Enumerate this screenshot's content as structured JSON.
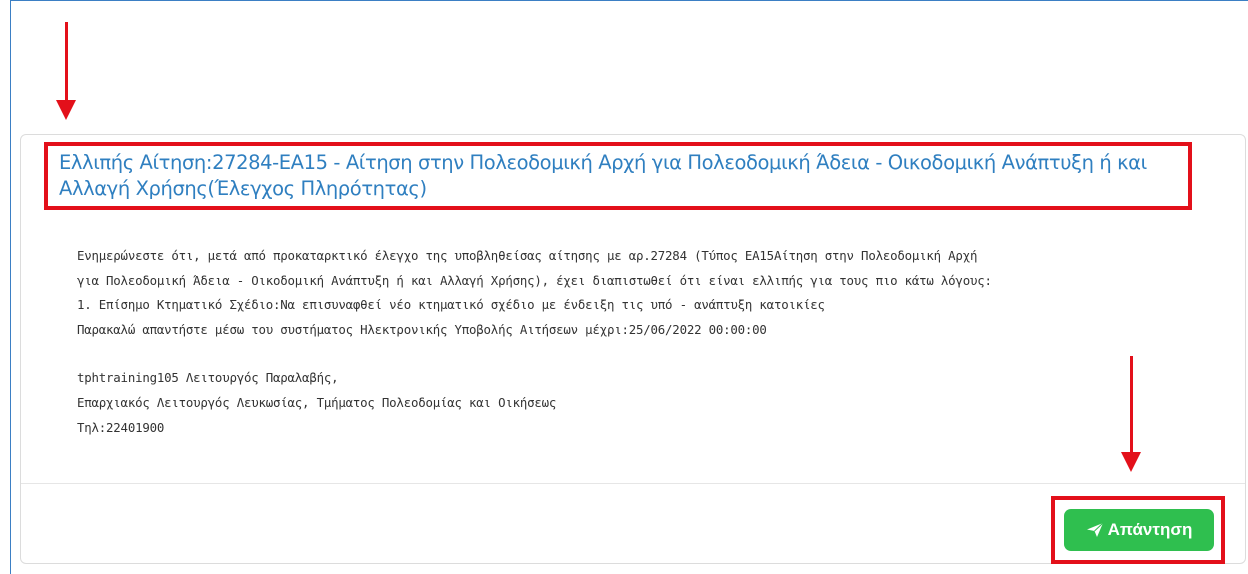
{
  "notice": {
    "title": "Ελλιπής Αίτηση:27284-ΕΑ15 - Αίτηση στην Πολεοδομική Αρχή για Πολεοδομική Άδεια - Οικοδομική Ανάπτυξη ή και Αλλαγή Χρήσης(Έλεγχος Πληρότητας)",
    "body_lines": [
      "Ενημερώνεστε ότι, μετά από προκαταρκτικό έλεγχο της υποβληθείσας αίτησης με αρ.27284 (Τύπος ΕΑ15Αίτηση στην Πολεοδομική Αρχή",
      "για Πολεοδομική Άδεια - Οικοδομική Ανάπτυξη ή και Αλλαγή Χρήσης), έχει διαπιστωθεί ότι είναι ελλιπής για τους πιο κάτω λόγους:",
      "1. Επίσημο Κτηματικό Σχέδιο:Να επισυναφθεί νέο κτηματικό σχέδιο με ένδειξη τις υπό - ανάπτυξη κατοικίες",
      "Παρακαλώ απαντήστε μέσω του συστήματος Ηλεκτρονικής Υποβολής Αιτήσεων μέχρι:25/06/2022 00:00:00"
    ],
    "signature_lines": [
      "tphtraining105 Λειτουργός Παραλαβής,",
      "Επαρχιακός Λειτουργός Λευκωσίας, Τμήματος Πολεοδομίας και Οικήσεως",
      "Τηλ:22401900"
    ]
  },
  "actions": {
    "reply_label": "Απάντηση",
    "reply_icon": "paper-plane-icon"
  },
  "colors": {
    "title": "#2f7fc0",
    "highlight": "#e3101a",
    "reply_button": "#2fbf4f"
  }
}
